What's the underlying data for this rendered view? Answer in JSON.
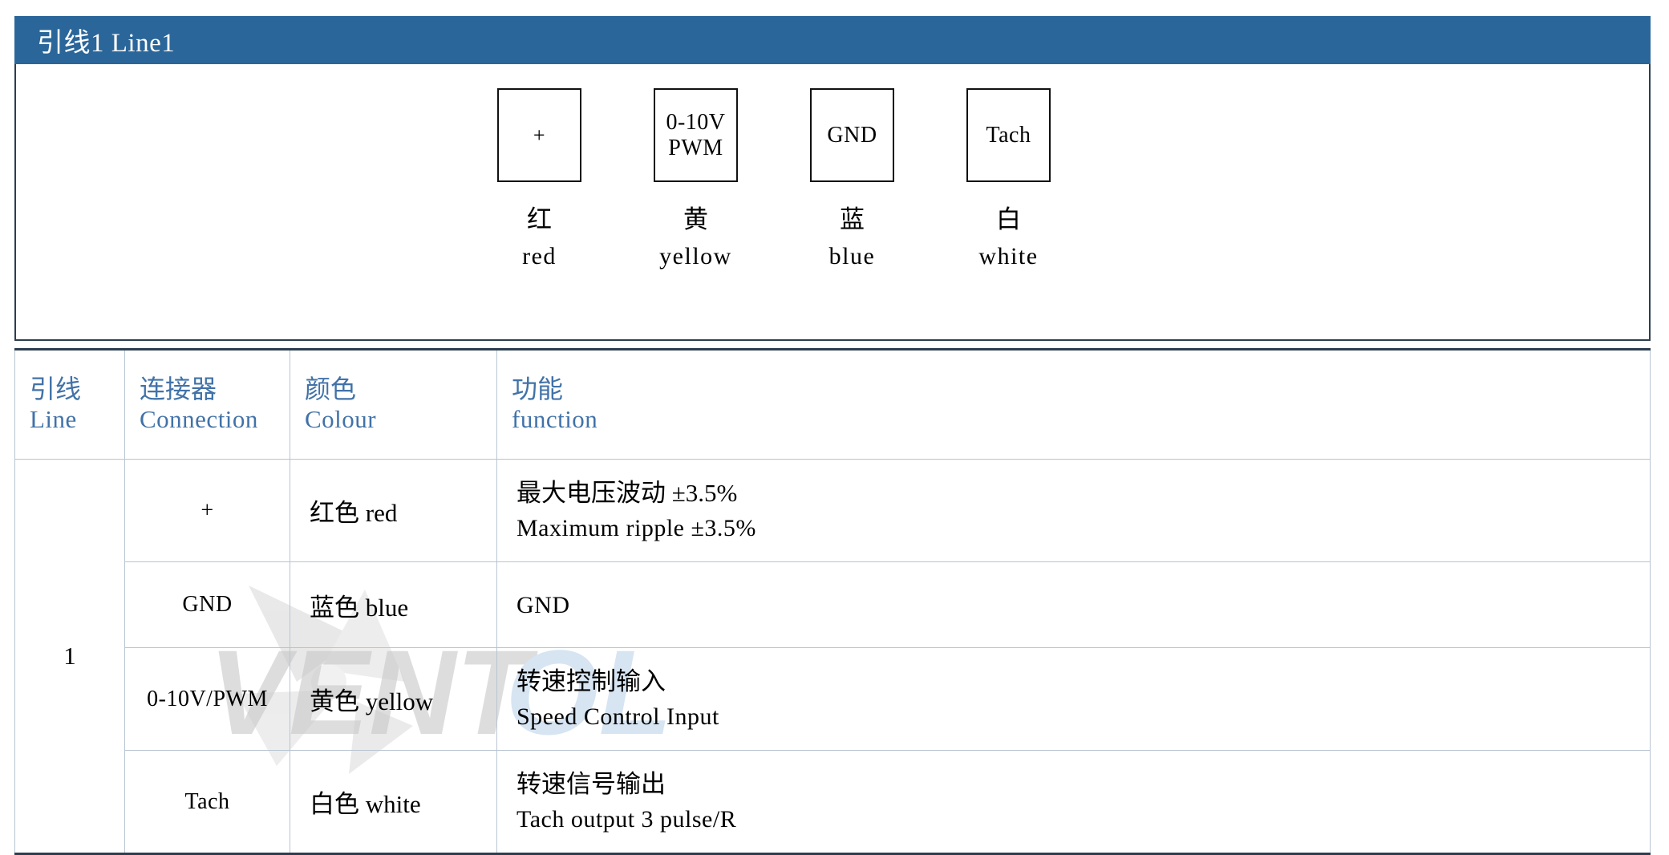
{
  "banner": {
    "title": "引线1 Line1"
  },
  "diagram": {
    "connectors": [
      {
        "box_lines": [
          "+"
        ],
        "label_cn": "红",
        "label_en": "red"
      },
      {
        "box_lines": [
          "0-10V",
          "PWM"
        ],
        "label_cn": "黄",
        "label_en": "yellow"
      },
      {
        "box_lines": [
          "GND"
        ],
        "label_cn": "蓝",
        "label_en": "blue"
      },
      {
        "box_lines": [
          "Tach"
        ],
        "label_cn": "白",
        "label_en": "white"
      }
    ]
  },
  "table": {
    "headers": [
      {
        "cn": "引线",
        "en": "Line"
      },
      {
        "cn": "连接器",
        "en": "Connection"
      },
      {
        "cn": "颜色",
        "en": "Colour"
      },
      {
        "cn": "功能",
        "en": "function"
      }
    ],
    "line_number": "1",
    "rows": [
      {
        "connection": "+",
        "colour": "红色 red",
        "function_cn": "最大电压波动 ±3.5%",
        "function_en": "Maximum ripple ±3.5%"
      },
      {
        "connection": "GND",
        "colour": "蓝色 blue",
        "function_cn": "",
        "function_en": "GND"
      },
      {
        "connection": "0-10V/PWM",
        "colour": "黄色 yellow",
        "function_cn": "转速控制输入",
        "function_en": "Speed Control Input"
      },
      {
        "connection": "Tach",
        "colour": "白色 white",
        "function_cn": "转速信号输出",
        "function_en": "Tach output 3 pulse/R"
      }
    ]
  },
  "watermark": {
    "text_gray": "VENT",
    "text_blue": "OL",
    "color_gray": "#c8c8c8",
    "color_blue": "#bdd3ea"
  },
  "colors": {
    "banner_blue": "#2a6699",
    "header_text_blue": "#4172a8",
    "grid_line": "#b8c4d2",
    "outer_border": "#2c3e50"
  }
}
